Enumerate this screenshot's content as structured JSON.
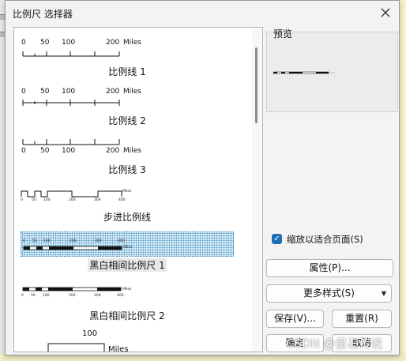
{
  "dialog": {
    "title": "比例尺 选择器",
    "close_icon": "close-icon"
  },
  "styles": [
    {
      "name": "比例线 1",
      "ticks": [
        "0",
        "50",
        "100",
        "200"
      ],
      "units": "Miles"
    },
    {
      "name": "比例线 2",
      "ticks": [
        "0",
        "50",
        "100",
        "200"
      ],
      "units": "Miles"
    },
    {
      "name": "比例线 3",
      "ticks": [
        "0",
        "50",
        "100",
        "200"
      ],
      "units": "Miles"
    },
    {
      "name": "步进比例线",
      "ticks": [
        "0",
        "50",
        "100",
        "200",
        "300",
        "400"
      ],
      "units": "Miles"
    },
    {
      "name": "黑白相间比例尺 1",
      "ticks": [
        "0",
        "50",
        "100",
        "200",
        "300",
        "400"
      ],
      "units": "Miles",
      "selected": true
    },
    {
      "name": "黑白相间比例尺 2",
      "ticks": [
        "0",
        "50",
        "100",
        "200",
        "300",
        "400"
      ],
      "units": "Miles"
    },
    {
      "name": "",
      "ticks": [
        "100"
      ],
      "units": "Miles"
    }
  ],
  "preview": {
    "label": "预览"
  },
  "fit_option": {
    "label": "缩放以适合页面(S)",
    "checked": true
  },
  "buttons": {
    "properties": "属性(P)...",
    "more_styles": "更多样式(S)",
    "save": "保存(V)...",
    "reset": "重置(R)",
    "ok": "确定",
    "cancel": "取消"
  },
  "watermark": "CSDN @星石传说"
}
